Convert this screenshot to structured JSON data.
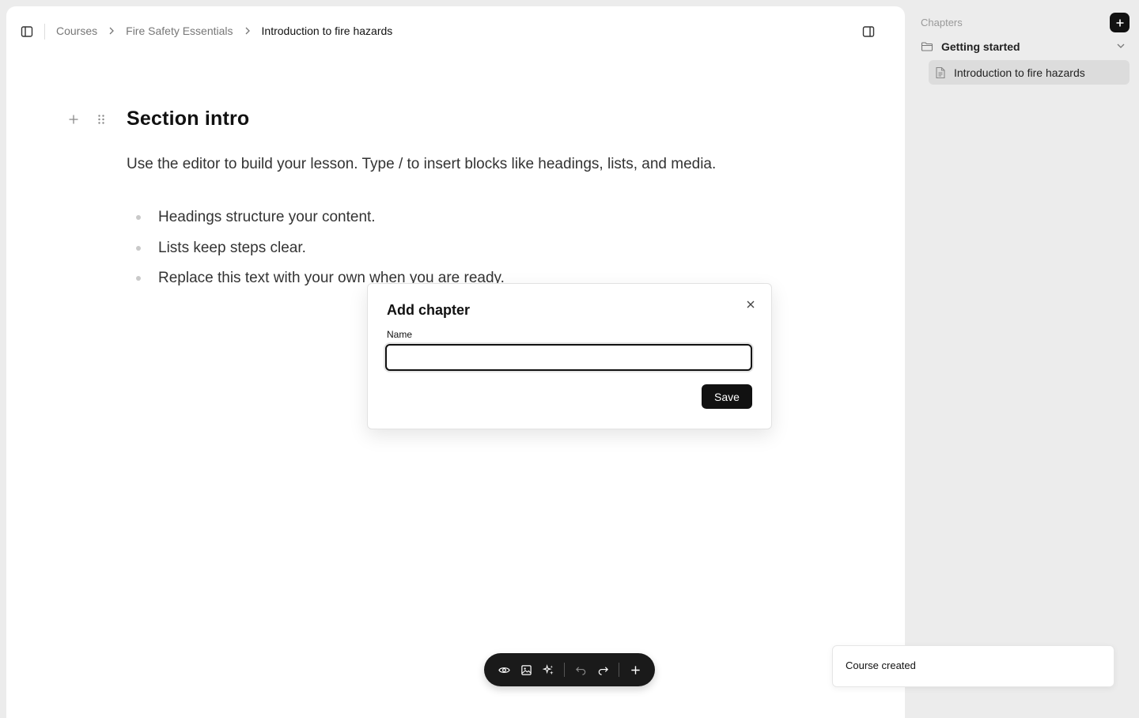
{
  "breadcrumb": {
    "items": [
      "Courses",
      "Fire Safety Essentials",
      "Introduction to fire hazards"
    ]
  },
  "editor": {
    "heading": "Section intro",
    "paragraph": "Use the editor to build your lesson. Type / to insert blocks like headings, lists, and media.",
    "bullets": [
      "Headings structure your content.",
      "Lists keep steps clear.",
      "Replace this text with your own when you are ready."
    ]
  },
  "modal": {
    "title": "Add chapter",
    "name_label": "Name",
    "name_value": "",
    "save_label": "Save"
  },
  "sidebar": {
    "title": "Chapters",
    "chapter": "Getting started",
    "lesson": "Introduction to fire hazards"
  },
  "toast": {
    "message": "Course created"
  },
  "icons": {
    "sidebar_toggle": "panel-left-icon",
    "panel_right": "panel-right-icon",
    "preview": "eye-icon",
    "image": "image-icon",
    "ai": "sparkles-icon",
    "undo": "undo-icon",
    "redo": "redo-icon",
    "add": "plus-icon"
  },
  "colors": {
    "sidebar_bg": "#ececec",
    "accent": "#111111",
    "lesson_active_bg": "#dcdcdc"
  }
}
